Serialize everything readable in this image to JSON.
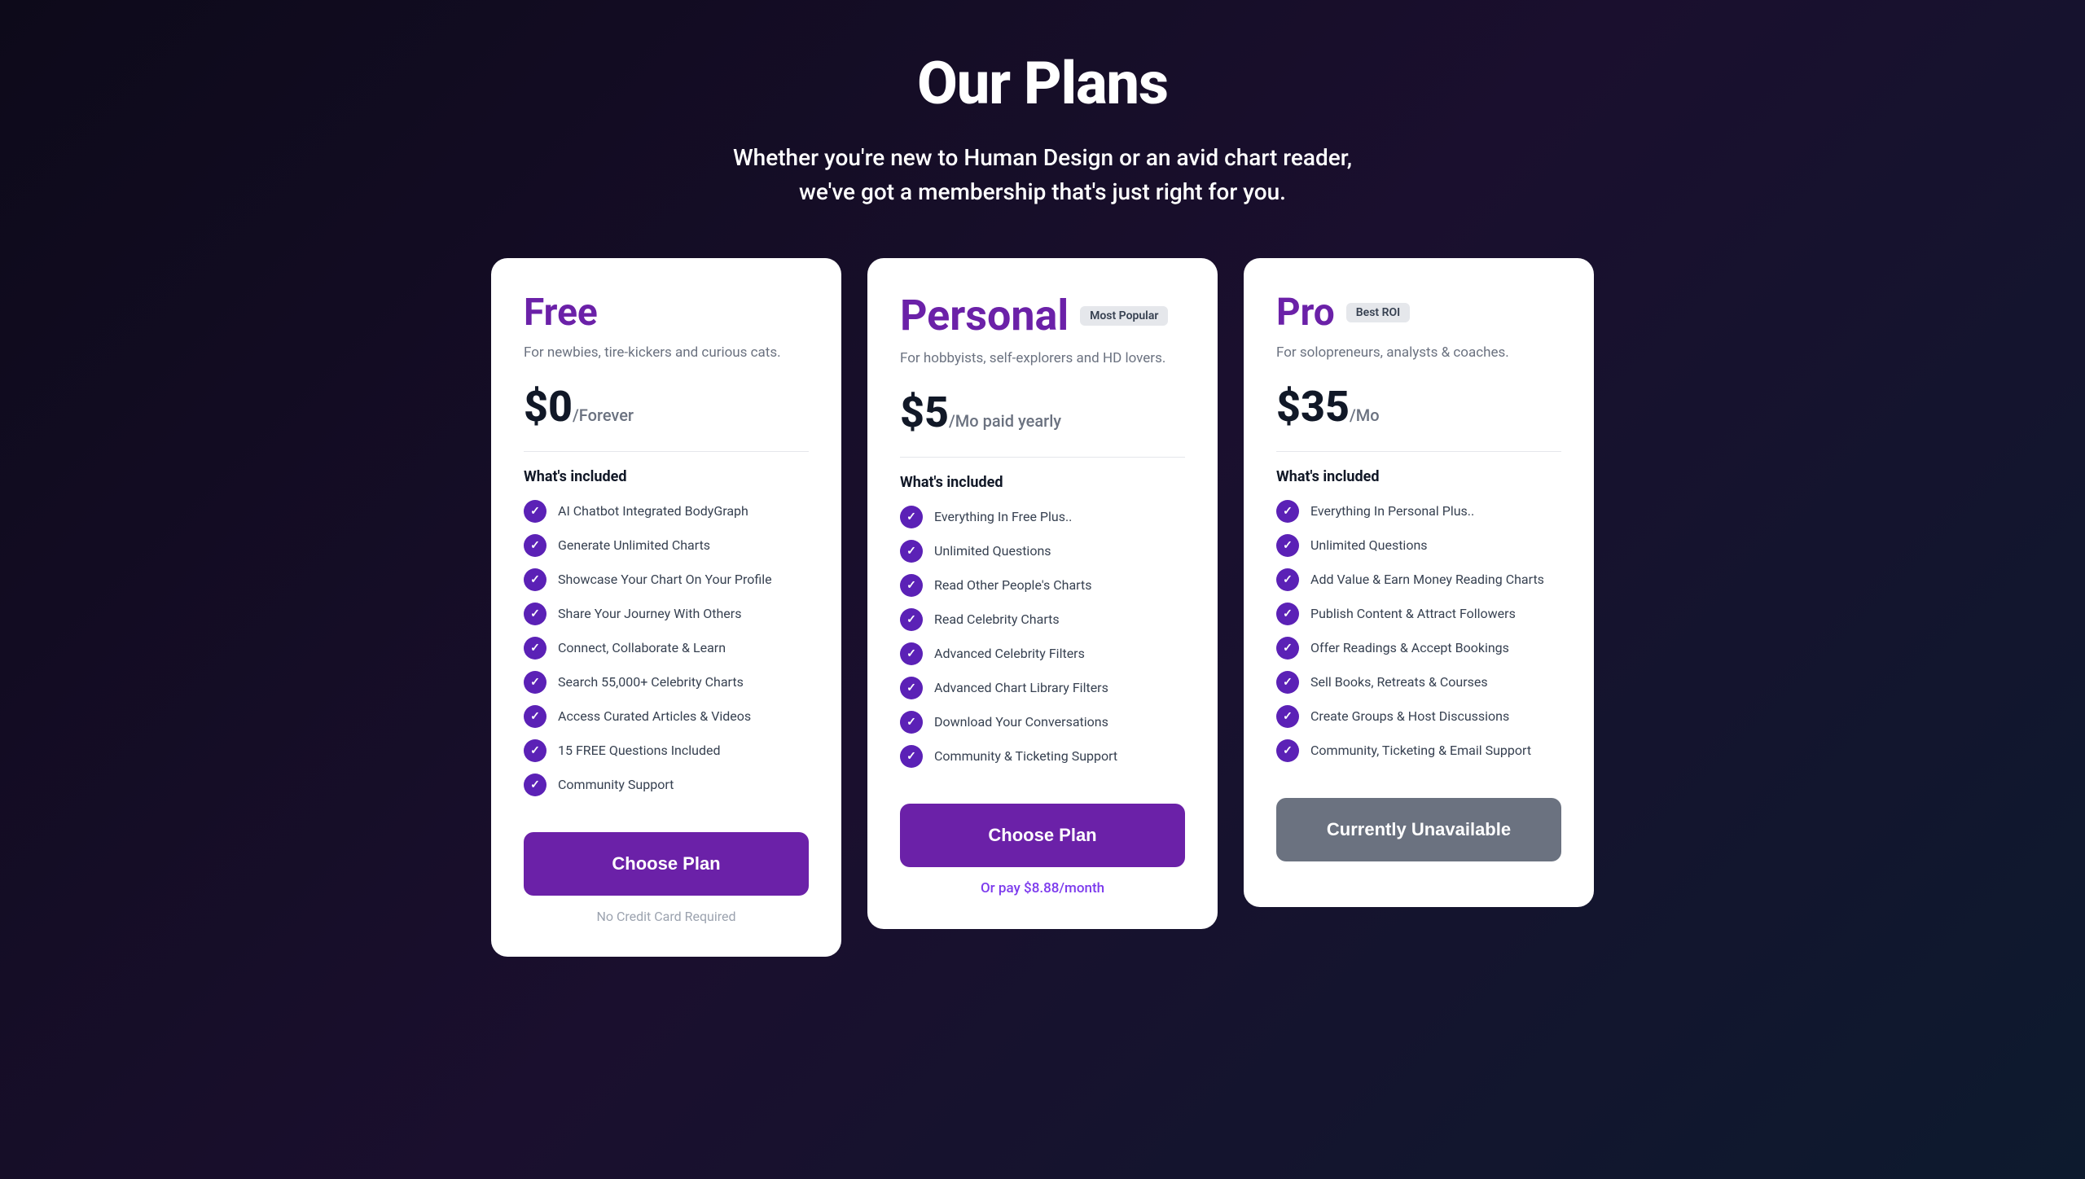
{
  "header": {
    "title": "Our Plans",
    "subtitle": "Whether you're new to Human Design or an avid chart reader, we've got a membership that's just right for you."
  },
  "plans": [
    {
      "id": "free",
      "name": "Free",
      "badge": null,
      "description": "For newbies, tire-kickers and curious cats.",
      "price": "$0",
      "period": "/Forever",
      "features_title": "What's included",
      "features": [
        "AI Chatbot Integrated BodyGraph",
        "Generate Unlimited Charts",
        "Showcase Your Chart On Your Profile",
        "Share Your Journey With Others",
        "Connect, Collaborate & Learn",
        "Search 55,000+ Celebrity Charts",
        "Access Curated Articles & Videos",
        "15 FREE Questions Included",
        "Community Support"
      ],
      "cta_label": "Choose Plan",
      "cta_type": "primary",
      "note": "No Credit Card Required",
      "note_type": "normal"
    },
    {
      "id": "personal",
      "name": "Personal",
      "badge": "Most Popular",
      "description": "For hobbyists, self-explorers and HD lovers.",
      "price": "$5",
      "period": "/Mo paid yearly",
      "features_title": "What's included",
      "features": [
        "Everything In Free Plus..",
        "Unlimited Questions",
        "Read Other People's Charts",
        "Read Celebrity Charts",
        "Advanced Celebrity Filters",
        "Advanced Chart Library Filters",
        "Download Your Conversations",
        "Community & Ticketing Support"
      ],
      "cta_label": "Choose Plan",
      "cta_type": "primary",
      "note": "Or pay $8.88/month",
      "note_type": "purple"
    },
    {
      "id": "pro",
      "name": "Pro",
      "badge": "Best ROI",
      "description": "For solopreneurs, analysts & coaches.",
      "price": "$35",
      "period": "/Mo",
      "features_title": "What's included",
      "features": [
        "Everything In Personal Plus..",
        "Unlimited Questions",
        "Add Value & Earn Money Reading Charts",
        "Publish Content & Attract Followers",
        "Offer Readings & Accept Bookings",
        "Sell Books, Retreats & Courses",
        "Create Groups & Host Discussions",
        "Community, Ticketing & Email Support"
      ],
      "cta_label": "Currently Unavailable",
      "cta_type": "disabled",
      "note": "",
      "note_type": "normal"
    }
  ]
}
